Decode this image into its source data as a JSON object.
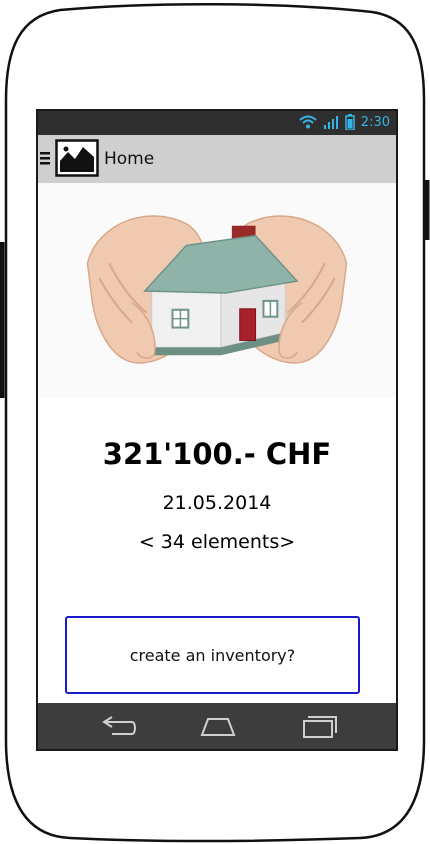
{
  "status_bar": {
    "time": "2:30",
    "icons": [
      "wifi-icon",
      "signal-icon",
      "battery-icon"
    ],
    "accent_color": "#33b5e5"
  },
  "app_bar": {
    "menu_icon": "menu-icon",
    "logo_icon": "image-placeholder-icon",
    "title": "Home"
  },
  "hero": {
    "icon": "house-in-hands-image"
  },
  "summary": {
    "amount": "321'100.- CHF",
    "date": "21.05.2014",
    "elements": "< 34 elements>"
  },
  "cta": {
    "label": "create an inventory?",
    "border_color": "#1a1acc"
  },
  "nav_bar": {
    "icons": [
      "back-icon",
      "home-icon",
      "recent-apps-icon"
    ]
  }
}
